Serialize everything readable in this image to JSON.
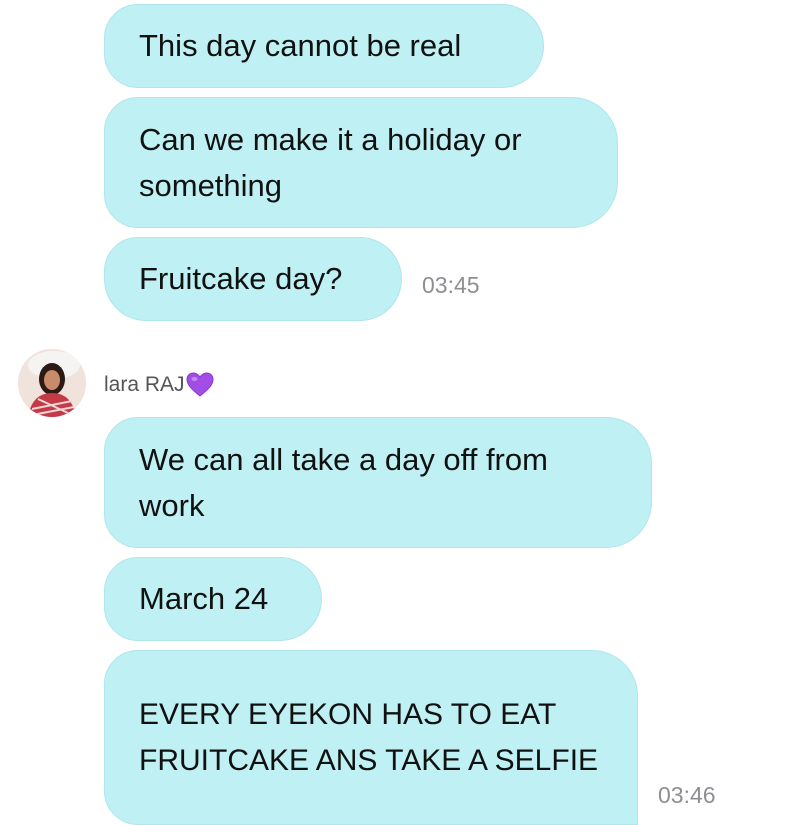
{
  "messages_top": [
    {
      "text": "This day cannot be real"
    },
    {
      "text": "Can we make it a holiday or something"
    },
    {
      "text": "Fruitcake day?",
      "time": "03:45"
    }
  ],
  "sender": {
    "name": "lara RAJ",
    "avatar_icon": "profile-photo",
    "badge_icon": "purple-heart-icon",
    "badge_color": "#a24de6"
  },
  "messages_bottom": [
    {
      "text": "We can all take a day off from work"
    },
    {
      "text": "March 24"
    },
    {
      "text": "EVERY EYEKON HAS TO EAT FRUITCAKE ANS TAKE A SELFIE",
      "time": "03:46"
    }
  ],
  "colors": {
    "bubble": "#bff0f4",
    "timestamp": "#8e8e93"
  }
}
